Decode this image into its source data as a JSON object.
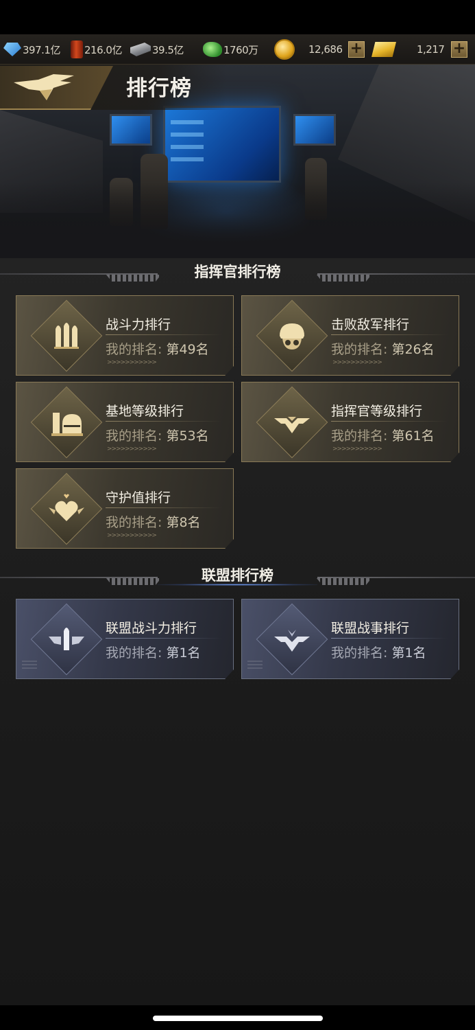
{
  "resources": {
    "diamond": "397.1亿",
    "oil": "216.0亿",
    "steel": "39.5亿",
    "cash": "1760万",
    "coins": "12,686",
    "gold": "1,217"
  },
  "page": {
    "title": "排行榜"
  },
  "commander_section": {
    "title": "指挥官排行榜",
    "rank_label": "我的排名:",
    "cards": [
      {
        "name": "战斗力排行",
        "rank": "第49名",
        "icon": "bullets-icon"
      },
      {
        "name": "击败敌军排行",
        "rank": "第26名",
        "icon": "helmet-skull-icon"
      },
      {
        "name": "基地等级排行",
        "rank": "第53名",
        "icon": "base-building-icon"
      },
      {
        "name": "指挥官等级排行",
        "rank": "第61名",
        "icon": "wings-chevron-icon"
      },
      {
        "name": "守护值排行",
        "rank": "第8名",
        "icon": "winged-heart-icon"
      }
    ]
  },
  "alliance_section": {
    "title": "联盟排行榜",
    "rank_label": "我的排名:",
    "cards": [
      {
        "name": "联盟战斗力排行",
        "rank": "第1名",
        "icon": "winged-bullet-icon"
      },
      {
        "name": "联盟战事排行",
        "rank": "第1名",
        "icon": "winged-chevron-icon"
      }
    ]
  },
  "colors": {
    "accent_gold": "#9c834d",
    "card_gold": "#5b5443",
    "card_alliance": "#4a5068"
  }
}
